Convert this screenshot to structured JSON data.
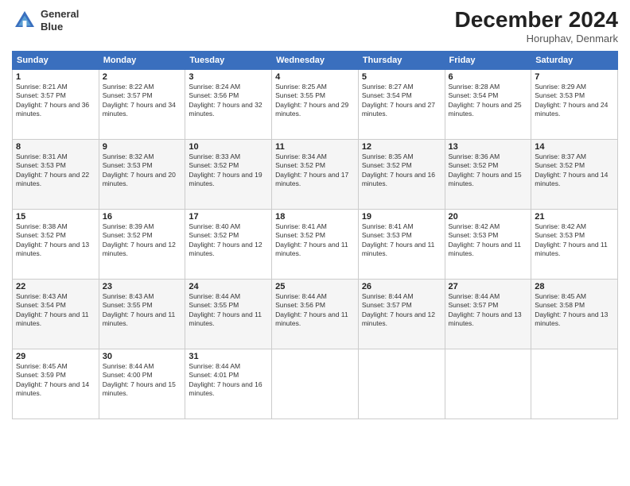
{
  "header": {
    "logo_line1": "General",
    "logo_line2": "Blue",
    "month_title": "December 2024",
    "location": "Horuphav, Denmark"
  },
  "days_of_week": [
    "Sunday",
    "Monday",
    "Tuesday",
    "Wednesday",
    "Thursday",
    "Friday",
    "Saturday"
  ],
  "weeks": [
    [
      {
        "day": "1",
        "sunrise": "Sunrise: 8:21 AM",
        "sunset": "Sunset: 3:57 PM",
        "daylight": "Daylight: 7 hours and 36 minutes."
      },
      {
        "day": "2",
        "sunrise": "Sunrise: 8:22 AM",
        "sunset": "Sunset: 3:57 PM",
        "daylight": "Daylight: 7 hours and 34 minutes."
      },
      {
        "day": "3",
        "sunrise": "Sunrise: 8:24 AM",
        "sunset": "Sunset: 3:56 PM",
        "daylight": "Daylight: 7 hours and 32 minutes."
      },
      {
        "day": "4",
        "sunrise": "Sunrise: 8:25 AM",
        "sunset": "Sunset: 3:55 PM",
        "daylight": "Daylight: 7 hours and 29 minutes."
      },
      {
        "day": "5",
        "sunrise": "Sunrise: 8:27 AM",
        "sunset": "Sunset: 3:54 PM",
        "daylight": "Daylight: 7 hours and 27 minutes."
      },
      {
        "day": "6",
        "sunrise": "Sunrise: 8:28 AM",
        "sunset": "Sunset: 3:54 PM",
        "daylight": "Daylight: 7 hours and 25 minutes."
      },
      {
        "day": "7",
        "sunrise": "Sunrise: 8:29 AM",
        "sunset": "Sunset: 3:53 PM",
        "daylight": "Daylight: 7 hours and 24 minutes."
      }
    ],
    [
      {
        "day": "8",
        "sunrise": "Sunrise: 8:31 AM",
        "sunset": "Sunset: 3:53 PM",
        "daylight": "Daylight: 7 hours and 22 minutes."
      },
      {
        "day": "9",
        "sunrise": "Sunrise: 8:32 AM",
        "sunset": "Sunset: 3:53 PM",
        "daylight": "Daylight: 7 hours and 20 minutes."
      },
      {
        "day": "10",
        "sunrise": "Sunrise: 8:33 AM",
        "sunset": "Sunset: 3:52 PM",
        "daylight": "Daylight: 7 hours and 19 minutes."
      },
      {
        "day": "11",
        "sunrise": "Sunrise: 8:34 AM",
        "sunset": "Sunset: 3:52 PM",
        "daylight": "Daylight: 7 hours and 17 minutes."
      },
      {
        "day": "12",
        "sunrise": "Sunrise: 8:35 AM",
        "sunset": "Sunset: 3:52 PM",
        "daylight": "Daylight: 7 hours and 16 minutes."
      },
      {
        "day": "13",
        "sunrise": "Sunrise: 8:36 AM",
        "sunset": "Sunset: 3:52 PM",
        "daylight": "Daylight: 7 hours and 15 minutes."
      },
      {
        "day": "14",
        "sunrise": "Sunrise: 8:37 AM",
        "sunset": "Sunset: 3:52 PM",
        "daylight": "Daylight: 7 hours and 14 minutes."
      }
    ],
    [
      {
        "day": "15",
        "sunrise": "Sunrise: 8:38 AM",
        "sunset": "Sunset: 3:52 PM",
        "daylight": "Daylight: 7 hours and 13 minutes."
      },
      {
        "day": "16",
        "sunrise": "Sunrise: 8:39 AM",
        "sunset": "Sunset: 3:52 PM",
        "daylight": "Daylight: 7 hours and 12 minutes."
      },
      {
        "day": "17",
        "sunrise": "Sunrise: 8:40 AM",
        "sunset": "Sunset: 3:52 PM",
        "daylight": "Daylight: 7 hours and 12 minutes."
      },
      {
        "day": "18",
        "sunrise": "Sunrise: 8:41 AM",
        "sunset": "Sunset: 3:52 PM",
        "daylight": "Daylight: 7 hours and 11 minutes."
      },
      {
        "day": "19",
        "sunrise": "Sunrise: 8:41 AM",
        "sunset": "Sunset: 3:53 PM",
        "daylight": "Daylight: 7 hours and 11 minutes."
      },
      {
        "day": "20",
        "sunrise": "Sunrise: 8:42 AM",
        "sunset": "Sunset: 3:53 PM",
        "daylight": "Daylight: 7 hours and 11 minutes."
      },
      {
        "day": "21",
        "sunrise": "Sunrise: 8:42 AM",
        "sunset": "Sunset: 3:53 PM",
        "daylight": "Daylight: 7 hours and 11 minutes."
      }
    ],
    [
      {
        "day": "22",
        "sunrise": "Sunrise: 8:43 AM",
        "sunset": "Sunset: 3:54 PM",
        "daylight": "Daylight: 7 hours and 11 minutes."
      },
      {
        "day": "23",
        "sunrise": "Sunrise: 8:43 AM",
        "sunset": "Sunset: 3:55 PM",
        "daylight": "Daylight: 7 hours and 11 minutes."
      },
      {
        "day": "24",
        "sunrise": "Sunrise: 8:44 AM",
        "sunset": "Sunset: 3:55 PM",
        "daylight": "Daylight: 7 hours and 11 minutes."
      },
      {
        "day": "25",
        "sunrise": "Sunrise: 8:44 AM",
        "sunset": "Sunset: 3:56 PM",
        "daylight": "Daylight: 7 hours and 11 minutes."
      },
      {
        "day": "26",
        "sunrise": "Sunrise: 8:44 AM",
        "sunset": "Sunset: 3:57 PM",
        "daylight": "Daylight: 7 hours and 12 minutes."
      },
      {
        "day": "27",
        "sunrise": "Sunrise: 8:44 AM",
        "sunset": "Sunset: 3:57 PM",
        "daylight": "Daylight: 7 hours and 13 minutes."
      },
      {
        "day": "28",
        "sunrise": "Sunrise: 8:45 AM",
        "sunset": "Sunset: 3:58 PM",
        "daylight": "Daylight: 7 hours and 13 minutes."
      }
    ],
    [
      {
        "day": "29",
        "sunrise": "Sunrise: 8:45 AM",
        "sunset": "Sunset: 3:59 PM",
        "daylight": "Daylight: 7 hours and 14 minutes."
      },
      {
        "day": "30",
        "sunrise": "Sunrise: 8:44 AM",
        "sunset": "Sunset: 4:00 PM",
        "daylight": "Daylight: 7 hours and 15 minutes."
      },
      {
        "day": "31",
        "sunrise": "Sunrise: 8:44 AM",
        "sunset": "Sunset: 4:01 PM",
        "daylight": "Daylight: 7 hours and 16 minutes."
      },
      null,
      null,
      null,
      null
    ]
  ]
}
